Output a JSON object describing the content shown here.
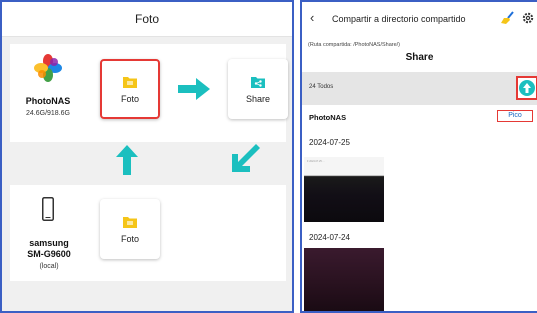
{
  "left_panel": {
    "title": "Foto",
    "nas": {
      "name": "PhotoNAS",
      "storage": "24.6G/918.6G",
      "source_tile_label": "Foto",
      "target_tile_label": "Share"
    },
    "phone": {
      "name_line1": "samsung",
      "name_line2": "SM-G9600",
      "status": "(local)",
      "tile_label": "Foto"
    }
  },
  "right_panel": {
    "header_title": "Compartir a directorio compartido",
    "path_text": "(Ruta compartida: /PhotoNAS/Share/)",
    "folder_title": "Share",
    "count_label": "24 Todos",
    "section_title": "PhotoNAS",
    "section_action": "Pico",
    "dates": [
      "2024-07-25",
      "2024-07-24"
    ],
    "thumb_caption": "F 2024.07.25 ..."
  },
  "colors": {
    "accent_teal": "#1bbfbf",
    "highlight_red": "#e53935",
    "folder_yellow": "#f5c518",
    "border_blue": "#3b5fc4"
  },
  "icons": [
    "photos-pinwheel-icon",
    "phone-icon",
    "folder-icon",
    "share-folder-icon",
    "arrow-right-icon",
    "arrow-up-icon",
    "arrow-down-left-icon",
    "back-icon",
    "broom-icon",
    "gear-icon",
    "upload-icon"
  ]
}
